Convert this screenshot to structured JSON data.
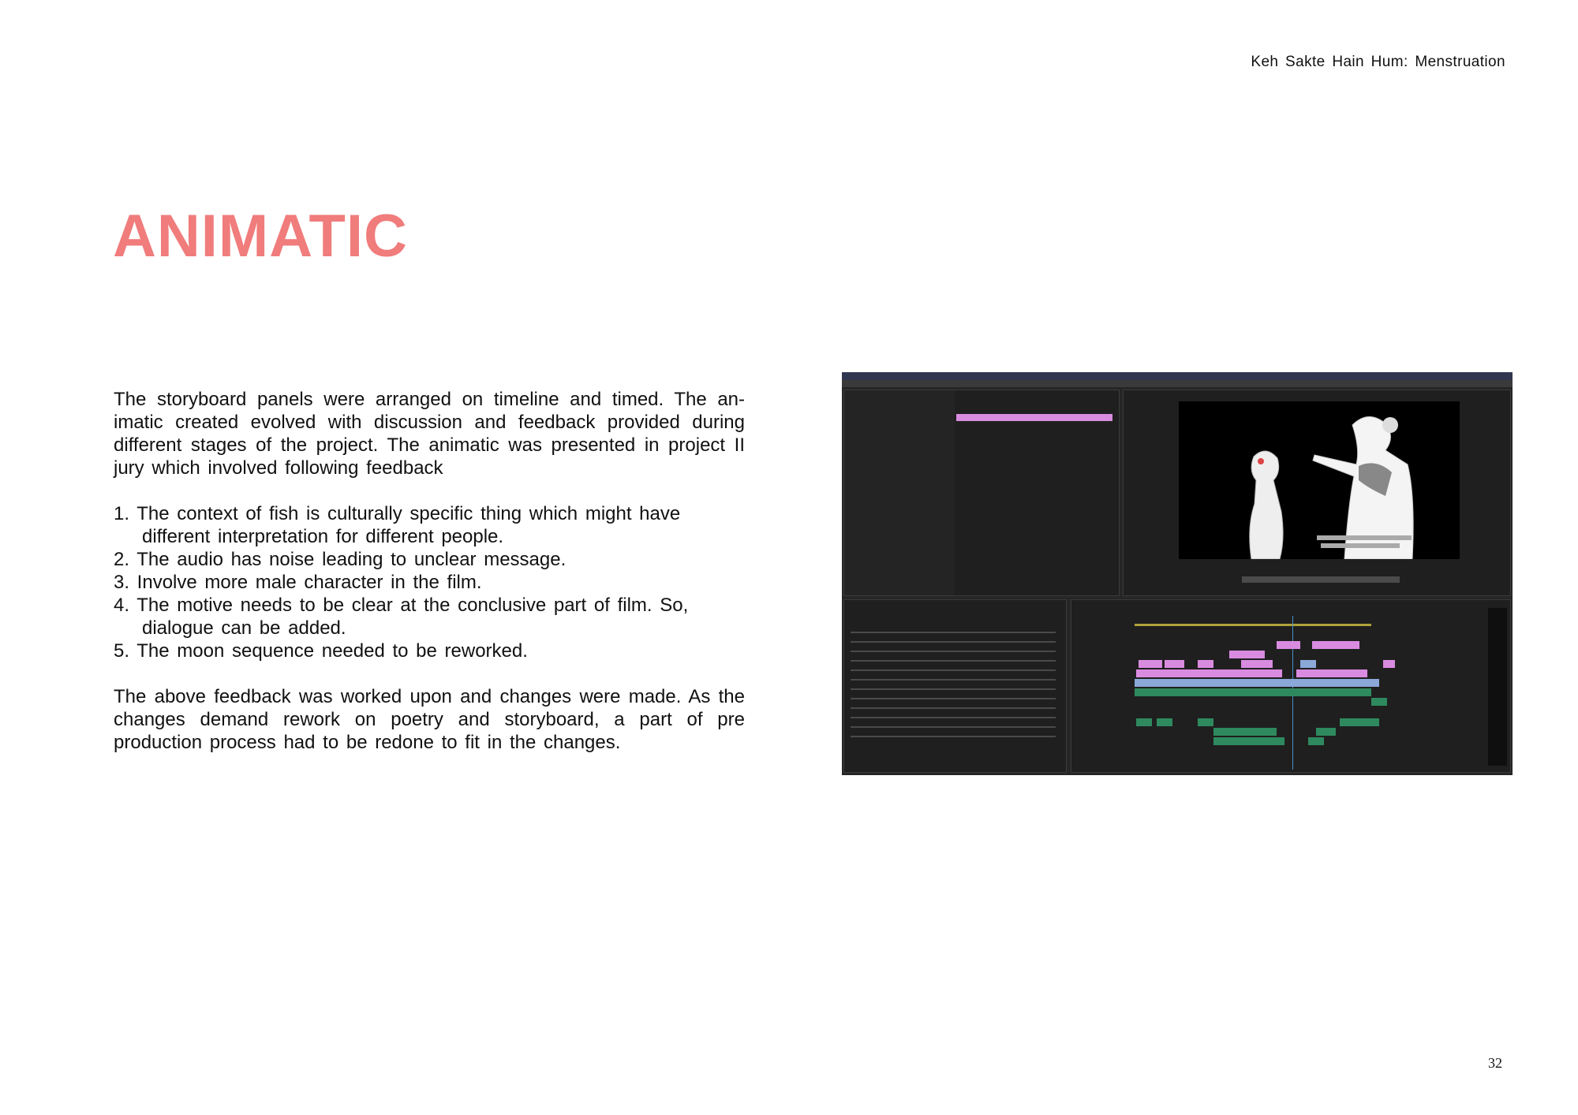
{
  "header": {
    "title": "Keh Sakte Hain Hum: Menstruation"
  },
  "page": {
    "title": "ANIMATIC",
    "number": "32"
  },
  "body": {
    "intro": "The storyboard panels were arranged on timeline and timed. The an-imatic created evolved with discussion and feedback provided during different stages of the project. The animatic was presented in project II jury which involved following feedback",
    "feedback": [
      "1. The context of fish is culturally specific thing which might have different interpretation for different people.",
      "2. The audio has noise leading to unclear message.",
      "3. Involve more male character in the film.",
      "4. The motive needs to be clear at the conclusive part of film. So, dialogue can be added.",
      "5. The moon sequence needed to be reworked."
    ],
    "conclusion": "The above feedback was worked upon and changes were made. As the changes demand rework on poetry and storyboard, a part of pre production process had to be redone to fit in the changes."
  },
  "colors": {
    "accent": "#f07c7c",
    "clip_pink": "#d98be0",
    "clip_green": "#2e8a5e",
    "clip_blue": "#8aa8d8"
  }
}
